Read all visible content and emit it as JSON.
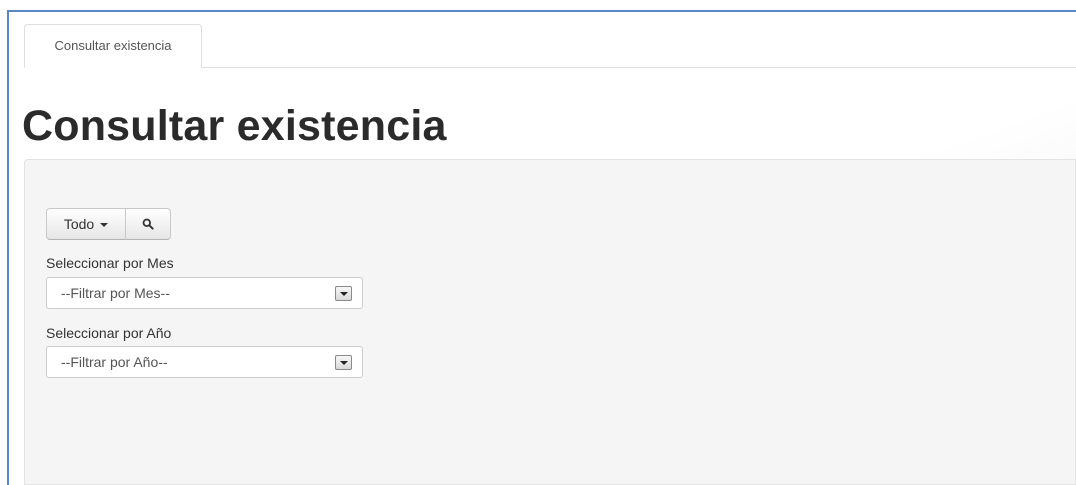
{
  "tabs": [
    {
      "label": "Consultar existencia"
    }
  ],
  "page": {
    "title": "Consultar existencia"
  },
  "toolbar": {
    "filter_label": "Todo",
    "search_icon": "search-icon"
  },
  "filters": {
    "month": {
      "label": "Seleccionar por Mes",
      "value": "--Filtrar por Mes--"
    },
    "year": {
      "label": "Seleccionar por Año",
      "value": "--Filtrar por Año--"
    }
  }
}
